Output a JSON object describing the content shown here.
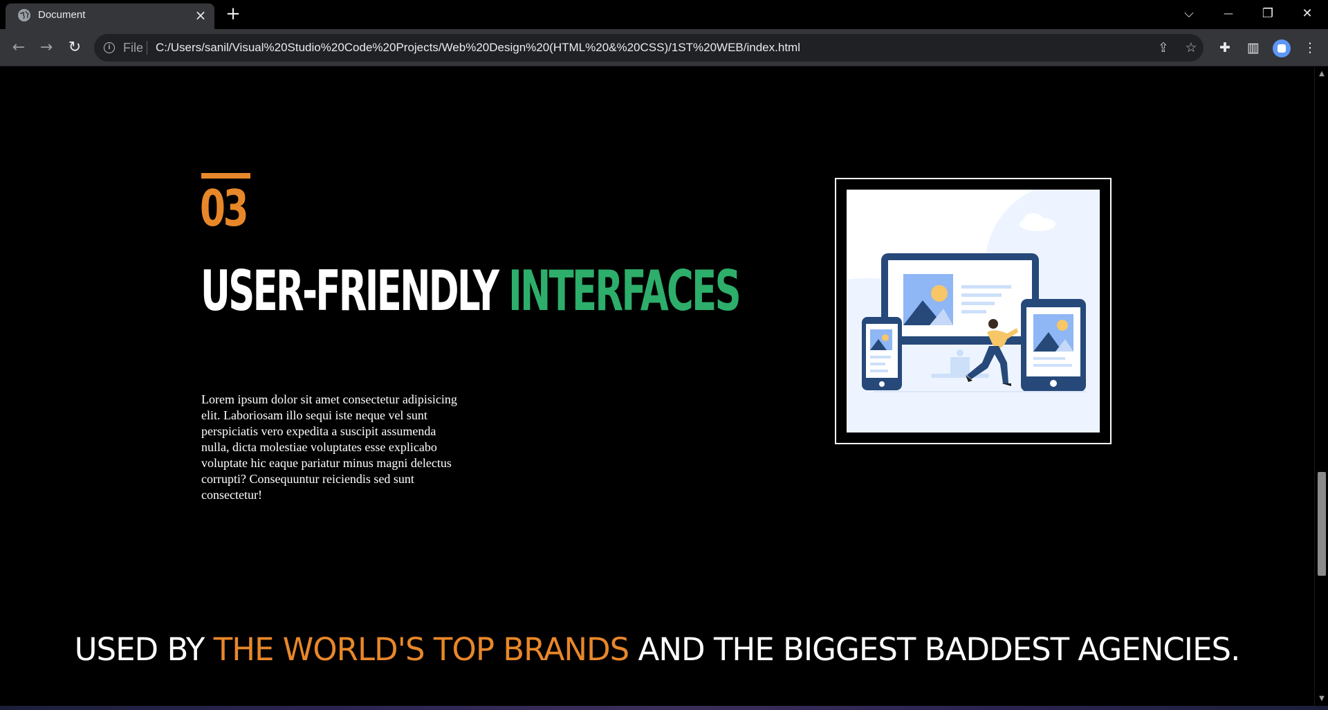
{
  "browser": {
    "tab_title": "Document",
    "new_tab": "+",
    "window_controls": {
      "list": "⌵",
      "minimize": "—",
      "restore": "❐",
      "close": "✕"
    },
    "nav": {
      "back": "←",
      "forward": "→",
      "reload": "↻"
    },
    "address": {
      "scheme": "File",
      "url": "C:/Users/sanil/Visual%20Studio%20Code%20Projects/Web%20Design%20(HTML%20&%20CSS)/1ST%20WEB/index.html"
    },
    "icons": [
      "site-info-icon",
      "share-icon",
      "bookmark-star-icon",
      "extensions-icon",
      "side-panel-icon",
      "profile-avatar",
      "menu-icon"
    ]
  },
  "section": {
    "number": "03",
    "headline_white": "USER-FRIENDLY",
    "headline_green": "INTERFACES",
    "body": "Lorem ipsum dolor sit amet consectetur adipisicing elit. Laboriosam illo sequi iste neque vel sunt perspiciatis vero expedita a suscipit assumenda nulla, dicta molestiae voluptates esse explicabo voluptate hic eaque pariatur minus magni delectus corrupti? Consequuntur reiciendis sed sunt consectetur!",
    "image": "responsive-devices-illustration"
  },
  "brands": {
    "part1": "USED BY ",
    "highlight": "THE WORLD'S TOP BRANDS",
    "part2": " AND THE BIGGEST BADDEST AGENCIES."
  },
  "colors": {
    "accent_orange": "#e8872a",
    "accent_green": "#2dae6b",
    "background": "#000000",
    "chrome": "#35363a"
  }
}
